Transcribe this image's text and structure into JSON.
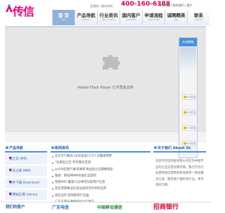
{
  "brand": {
    "name": "传信",
    "tagline": "CHUANXIN"
  },
  "header": {
    "hotline_label": "全国统一服务热线:",
    "hotline_number": "400-160-6388",
    "top_links": "常见问题 | 联系我们 | 客户"
  },
  "nav": [
    {
      "label": "首 页",
      "sub": "HOME",
      "active": true
    },
    {
      "label": "产品导航",
      "sub": "PRODUCT",
      "active": false
    },
    {
      "label": "行业资讯",
      "sub": "NEWS CENTER",
      "active": false
    },
    {
      "label": "国内客户",
      "sub": "CUSTOMER",
      "active": false
    },
    {
      "label": "申请流程",
      "sub": "APPLY FLOW",
      "active": false
    },
    {
      "label": "诚聘精英",
      "sub": "JOBS",
      "active": false
    },
    {
      "label": "联系",
      "sub": "CONTACT",
      "active": false
    }
  ],
  "banner": {
    "message": "Adobe Flash Player 已不再受支持"
  },
  "service": {
    "title": "在线客服",
    "qq": [
      "QQ交谈",
      "QQ交谈",
      "QQ交谈",
      "QQ交谈"
    ]
  },
  "products": {
    "title": "产品导航",
    "items": [
      "短之信 SMS",
      "彩信之家 MMS",
      "软件下载 Download",
      "常用短信库 Library"
    ]
  },
  "news": {
    "title": "新闻资讯",
    "items": [
      "北京市气象局 26日发送11万人次暴雨预警",
      "\"垃圾短之信\"存在概念差池",
      "公众对近期气象谣诼增 物业短之信刷数缺走",
      "独家：移动MM中有他在运营的",
      "免费WiFi 蕃客15分钟可玩取用户信息",
      "短信营销事业在商业协同合作中的应用",
      "短信业务 获利取用户自由",
      "广东东莞开通手机短之信停法"
    ]
  },
  "about": {
    "title": "关于我们 About Us",
    "body": "东莞市传信科技有限公司作为中国专业的企业信息化服务商，致力于为企业提供短信营销及移动商务一体化解决方案，服务客户遍布各行业，享有良好口碑。"
  },
  "customers": {
    "title": "我们的客户",
    "logos": [
      "广东电信",
      "中国移动通信",
      "招商银行"
    ]
  }
}
